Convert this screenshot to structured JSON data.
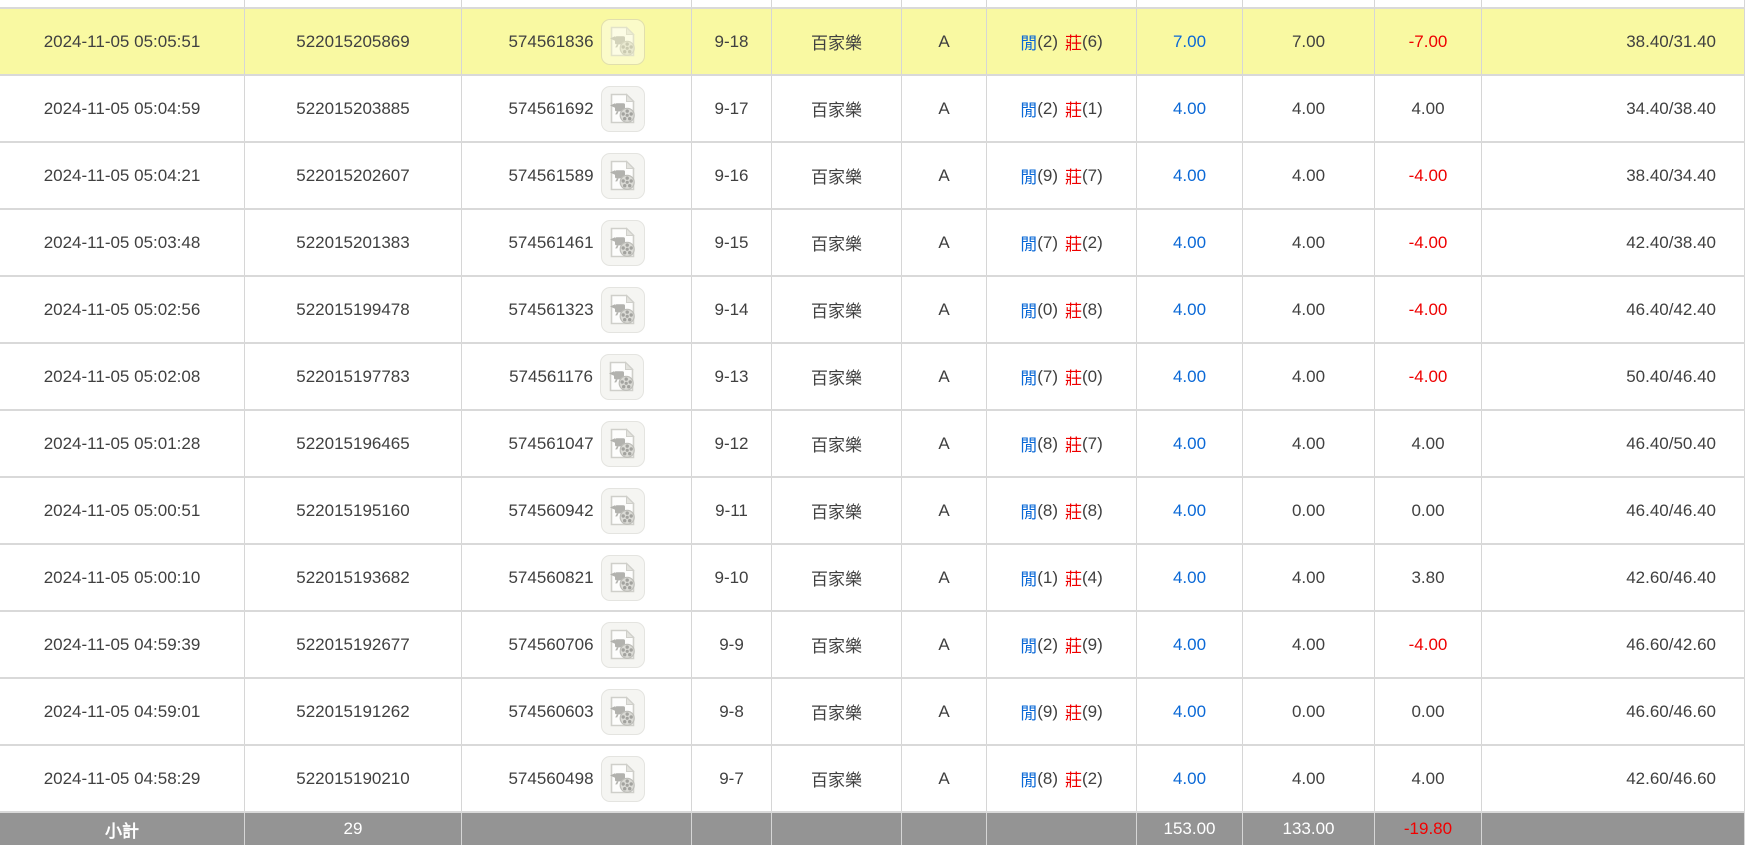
{
  "colors": {
    "highlight_row_bg": "#f9f9a2",
    "summary_row_bg": "#949494",
    "amount_blue": "#0a68d6",
    "loss_red": "#ee0000",
    "body_text": "#404040"
  },
  "icon": {
    "name": "video-replay-icon"
  },
  "table": {
    "player_label": "閒",
    "banker_label": "莊",
    "game_name": "百家樂",
    "rows": [
      {
        "time": "2024-11-05 05:05:51",
        "bet_id": "522015205869",
        "game_id": "574561836",
        "round": "9-18",
        "game": "百家樂",
        "table": "A",
        "player": "2",
        "banker": "6",
        "bet": "7.00",
        "valid": "7.00",
        "win": "-7.00",
        "balance": "38.40/31.40",
        "highlighted": true
      },
      {
        "time": "2024-11-05 05:04:59",
        "bet_id": "522015203885",
        "game_id": "574561692",
        "round": "9-17",
        "game": "百家樂",
        "table": "A",
        "player": "2",
        "banker": "1",
        "bet": "4.00",
        "valid": "4.00",
        "win": "4.00",
        "balance": "34.40/38.40",
        "highlighted": false
      },
      {
        "time": "2024-11-05 05:04:21",
        "bet_id": "522015202607",
        "game_id": "574561589",
        "round": "9-16",
        "game": "百家樂",
        "table": "A",
        "player": "9",
        "banker": "7",
        "bet": "4.00",
        "valid": "4.00",
        "win": "-4.00",
        "balance": "38.40/34.40",
        "highlighted": false
      },
      {
        "time": "2024-11-05 05:03:48",
        "bet_id": "522015201383",
        "game_id": "574561461",
        "round": "9-15",
        "game": "百家樂",
        "table": "A",
        "player": "7",
        "banker": "2",
        "bet": "4.00",
        "valid": "4.00",
        "win": "-4.00",
        "balance": "42.40/38.40",
        "highlighted": false
      },
      {
        "time": "2024-11-05 05:02:56",
        "bet_id": "522015199478",
        "game_id": "574561323",
        "round": "9-14",
        "game": "百家樂",
        "table": "A",
        "player": "0",
        "banker": "8",
        "bet": "4.00",
        "valid": "4.00",
        "win": "-4.00",
        "balance": "46.40/42.40",
        "highlighted": false
      },
      {
        "time": "2024-11-05 05:02:08",
        "bet_id": "522015197783",
        "game_id": "574561176",
        "round": "9-13",
        "game": "百家樂",
        "table": "A",
        "player": "7",
        "banker": "0",
        "bet": "4.00",
        "valid": "4.00",
        "win": "-4.00",
        "balance": "50.40/46.40",
        "highlighted": false
      },
      {
        "time": "2024-11-05 05:01:28",
        "bet_id": "522015196465",
        "game_id": "574561047",
        "round": "9-12",
        "game": "百家樂",
        "table": "A",
        "player": "8",
        "banker": "7",
        "bet": "4.00",
        "valid": "4.00",
        "win": "4.00",
        "balance": "46.40/50.40",
        "highlighted": false
      },
      {
        "time": "2024-11-05 05:00:51",
        "bet_id": "522015195160",
        "game_id": "574560942",
        "round": "9-11",
        "game": "百家樂",
        "table": "A",
        "player": "8",
        "banker": "8",
        "bet": "4.00",
        "valid": "0.00",
        "win": "0.00",
        "balance": "46.40/46.40",
        "highlighted": false
      },
      {
        "time": "2024-11-05 05:00:10",
        "bet_id": "522015193682",
        "game_id": "574560821",
        "round": "9-10",
        "game": "百家樂",
        "table": "A",
        "player": "1",
        "banker": "4",
        "bet": "4.00",
        "valid": "4.00",
        "win": "3.80",
        "balance": "42.60/46.40",
        "highlighted": false
      },
      {
        "time": "2024-11-05 04:59:39",
        "bet_id": "522015192677",
        "game_id": "574560706",
        "round": "9-9",
        "game": "百家樂",
        "table": "A",
        "player": "2",
        "banker": "9",
        "bet": "4.00",
        "valid": "4.00",
        "win": "-4.00",
        "balance": "46.60/42.60",
        "highlighted": false
      },
      {
        "time": "2024-11-05 04:59:01",
        "bet_id": "522015191262",
        "game_id": "574560603",
        "round": "9-8",
        "game": "百家樂",
        "table": "A",
        "player": "9",
        "banker": "9",
        "bet": "4.00",
        "valid": "0.00",
        "win": "0.00",
        "balance": "46.60/46.60",
        "highlighted": false
      },
      {
        "time": "2024-11-05 04:58:29",
        "bet_id": "522015190210",
        "game_id": "574560498",
        "round": "9-7",
        "game": "百家樂",
        "table": "A",
        "player": "8",
        "banker": "2",
        "bet": "4.00",
        "valid": "4.00",
        "win": "4.00",
        "balance": "42.60/46.60",
        "highlighted": false
      }
    ],
    "summary": {
      "label": "小計",
      "count": "29",
      "bet_total": "153.00",
      "valid_total": "133.00",
      "win_total": "-19.80"
    }
  }
}
